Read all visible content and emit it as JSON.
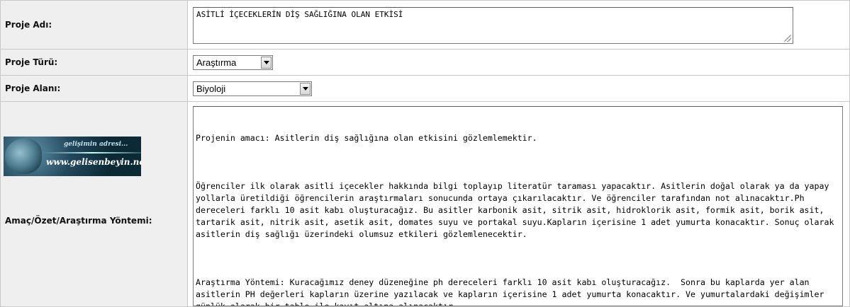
{
  "fields": {
    "name": {
      "label": "Proje Adı:",
      "value": "ASİTLİ İÇECEKLERİN DİŞ SAĞLIĞINA OLAN ETKİSİ"
    },
    "type": {
      "label": "Proje Türü:",
      "value": "Araştırma"
    },
    "area": {
      "label": "Proje Alanı:",
      "value": "Biyoloji"
    },
    "description": {
      "label": "Amaç/Özet/Araştırma Yöntemi:",
      "paragraphs": [
        "Projenin amacı: Asitlerin diş sağlığına olan etkisini gözlemlemektir.",
        "Öğrenciler ilk olarak asitli içecekler hakkında bilgi toplayıp literatür taraması yapacaktır. Asitlerin doğal olarak ya da yapay yollarla üretildiği öğrencilerin araştırmaları sonucunda ortaya çıkarılacaktır. Ve öğrenciler tarafından not alınacaktır.Ph dereceleri farklı 10 asit kabı oluşturacağız. Bu asitler karbonik asit, sitrik asit, hidroklorik asit, formik asit, borik asit, tartarik asit, nitrik asit, asetik asit, domates suyu ve portakal suyu.Kapların içerisine 1 adet yumurta konacaktır. Sonuç olarak asitlerin diş sağlığı üzerindeki olumsuz etkileri gözlemlenecektir.",
        "Araştırma Yöntemi: Kuracağımız deney düzeneğine ph dereceleri farklı 10 asit kabı oluşturacağız.  Sonra bu kaplarda yer alan asitlerin PH değerleri kapların üzerine yazılacak ve kapların içerisine 1 adet yumurta konacaktır. Ve yumurtalardaki değişimler günlük olarak bir tablo ile kayıt altına alınacaktır."
      ]
    }
  },
  "banner": {
    "slogan": "gelişimin adresi...",
    "site": "www.gelisenbeyin.net",
    "icon": "brain-icon"
  }
}
